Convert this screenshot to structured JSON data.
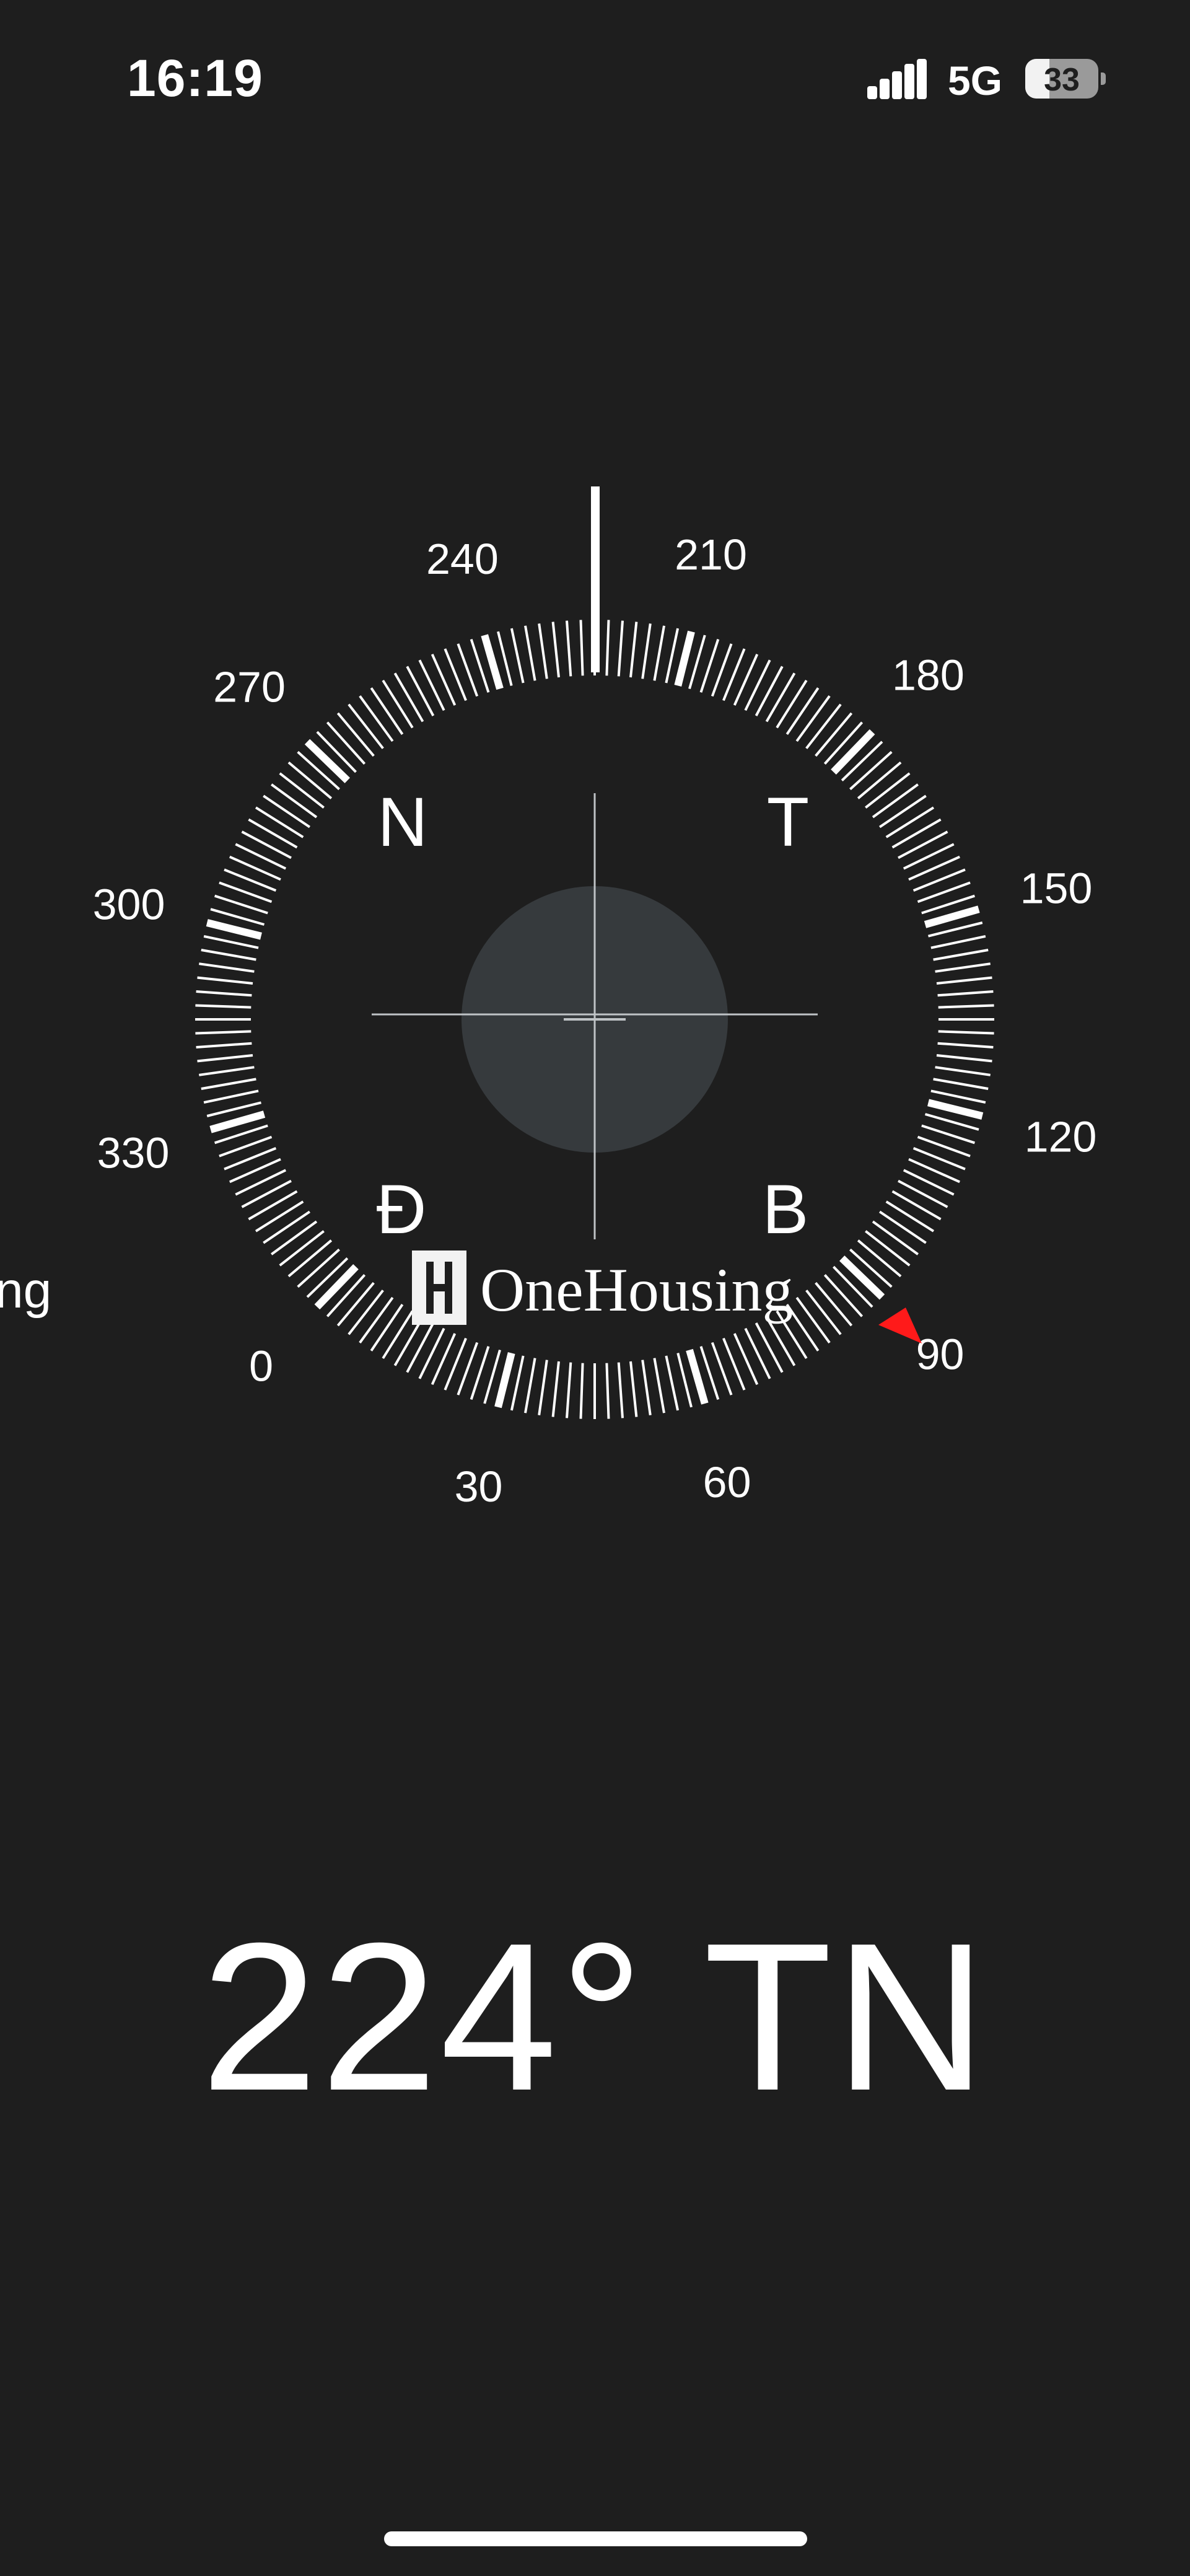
{
  "status_bar": {
    "time": "16:19",
    "network": "5G",
    "battery": "33",
    "battery_level_percent": 33,
    "icons": [
      "signal-icon",
      "battery-icon"
    ]
  },
  "compass": {
    "heading_degrees": 224,
    "degree_labels": [
      "0",
      "30",
      "60",
      "90",
      "120",
      "150",
      "180",
      "210",
      "240",
      "270",
      "300",
      "330"
    ],
    "cardinals": {
      "north": "N",
      "east": "Đ",
      "south": "B",
      "west": "T"
    },
    "left_edge_fragment": "ng",
    "watermark": "OneHousing",
    "watermark_icon": "onehousing-logo-icon",
    "marker_color": "#ff1a1a",
    "bubble_color": "#363a3d"
  },
  "readout": {
    "text": "224° TN"
  }
}
